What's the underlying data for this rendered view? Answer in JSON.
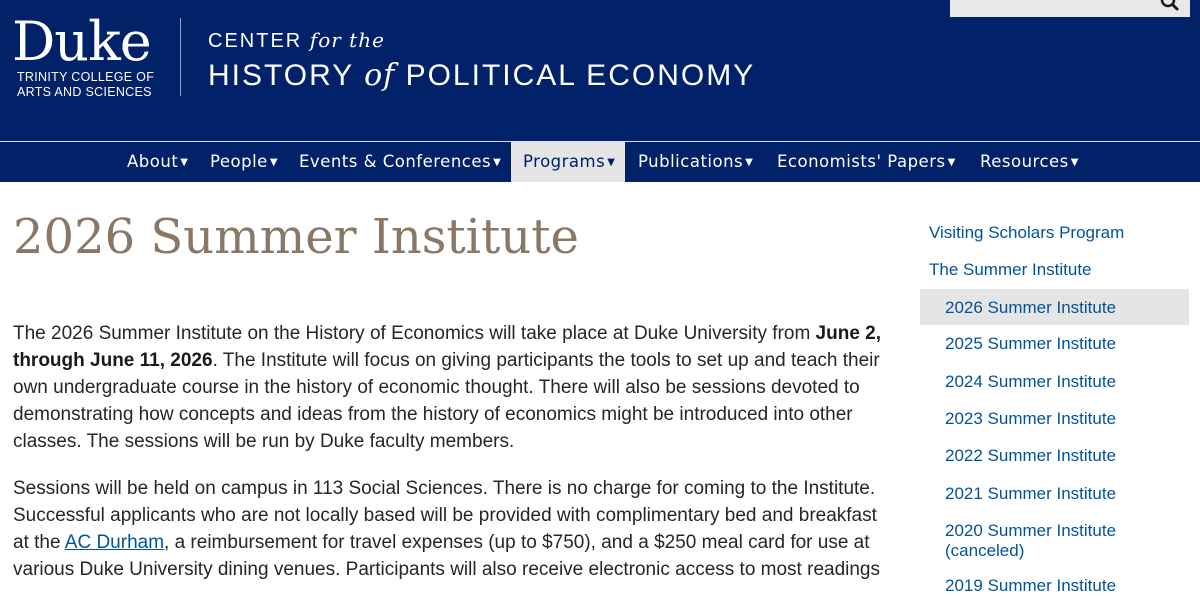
{
  "header": {
    "logo_word": "Duke",
    "logo_sub_1": "TRINITY COLLEGE OF",
    "logo_sub_2": "ARTS AND SCIENCES",
    "center_line1_a": "CENTER",
    "center_line1_b": "for the",
    "center_line2_a": "HISTORY",
    "center_line2_b": "of",
    "center_line2_c": "POLITICAL ECONOMY"
  },
  "nav": {
    "items": [
      {
        "label": "About"
      },
      {
        "label": "People"
      },
      {
        "label": "Events & Conferences"
      },
      {
        "label": "Programs"
      },
      {
        "label": "Publications"
      },
      {
        "label": "Economists' Papers"
      },
      {
        "label": "Resources"
      }
    ],
    "active": "Programs"
  },
  "main": {
    "title": "2026 Summer Institute",
    "p1_lines": [
      "The 2026 Summer Institute on the History of Economics will take place at Duke University from ",
      "June 2,",
      "through June 11, 2026",
      ". The Institute will focus on giving participants the tools to set up and teach their",
      "own undergraduate course in the history of economic thought. There will also be sessions devoted to",
      "demonstrating how concepts and ideas from the history of economics might be introduced into other",
      "classes. The sessions will be run by Duke faculty members."
    ],
    "p2_lines": [
      "Sessions will be held on campus in 113 Social Sciences. There is no charge for coming to the Institute.",
      "Successful applicants who are not locally based will be provided with complimentary bed and breakfast",
      "at the ",
      "AC Durham",
      ", a reimbursement for travel expenses (up to $750), and a $250 meal card for use at",
      "various Duke University dining venues. Participants will also receive electronic access to most readings"
    ]
  },
  "sidebar": {
    "top": [
      "Visiting Scholars Program",
      "The Summer Institute"
    ],
    "items": [
      "2026 Summer Institute",
      "2025 Summer Institute",
      "2024 Summer Institute",
      "2023 Summer Institute",
      "2022 Summer Institute",
      "2021 Summer Institute",
      "2020 Summer Institute",
      "(canceled)",
      "2019 Summer Institute"
    ],
    "active": "2026 Summer Institute"
  },
  "colors": {
    "duke_blue": "#012169",
    "title_taupe": "#8a7766",
    "link_blue": "#00539b",
    "active_bg": "#e5e5e5"
  }
}
